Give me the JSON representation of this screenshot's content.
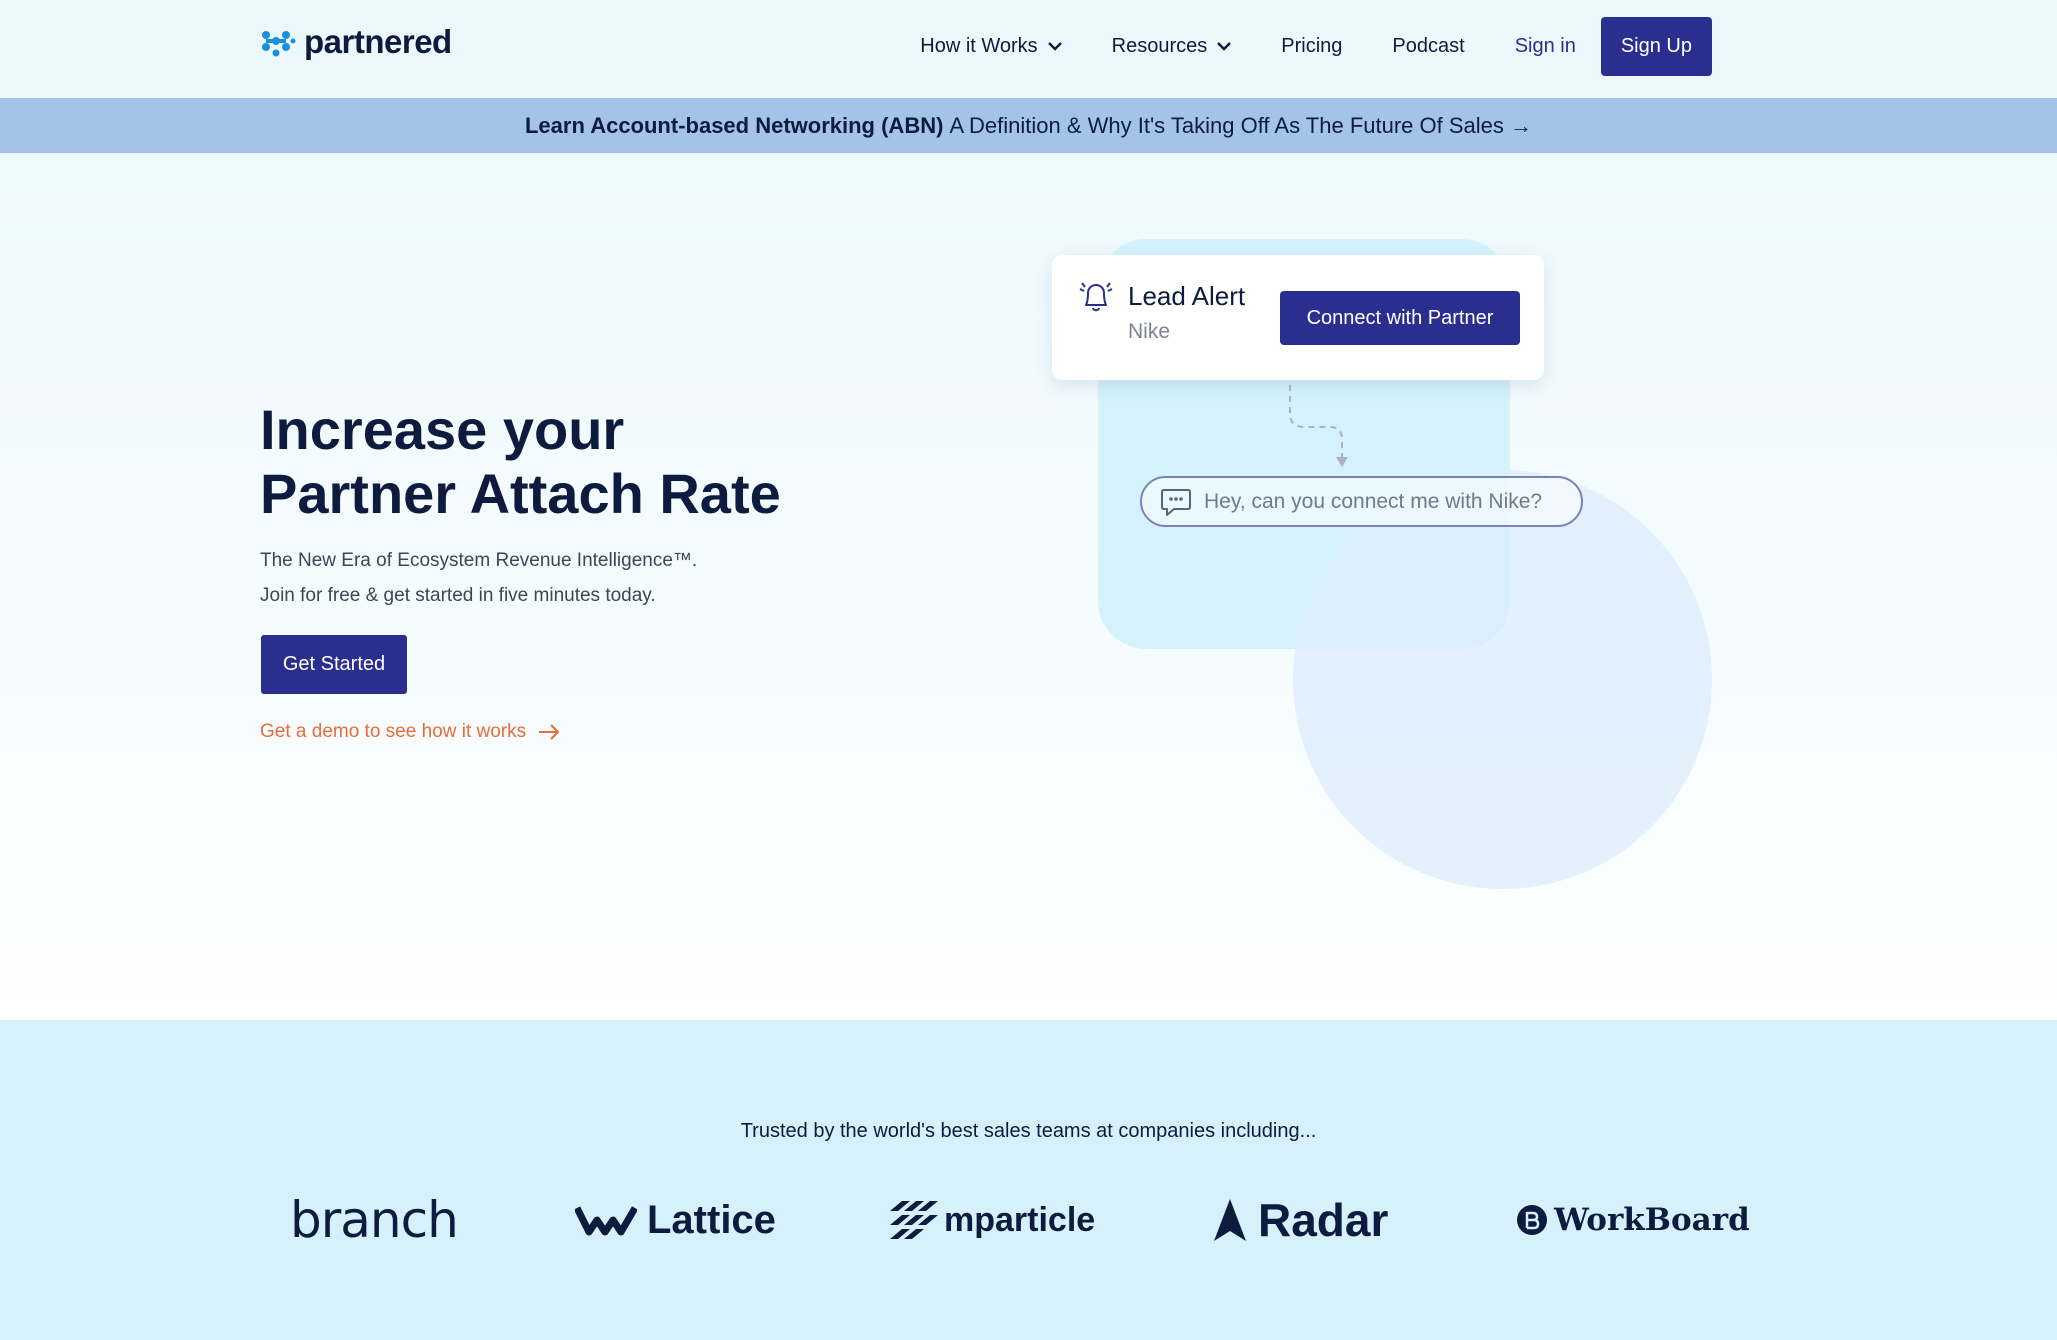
{
  "header": {
    "logo_text": "partnered",
    "nav": {
      "how_it_works": "How it Works",
      "resources": "Resources",
      "pricing": "Pricing",
      "podcast": "Podcast",
      "sign_in": "Sign in",
      "sign_up": "Sign Up"
    }
  },
  "banner": {
    "bold": "Learn Account-based Networking (ABN)",
    "rest": "A Definition & Why It's Taking Off As The Future Of Sales →"
  },
  "hero": {
    "title_line1": "Increase your",
    "title_line2": "Partner Attach Rate",
    "sub_line1": "The New Era of Ecosystem Revenue Intelligence™.",
    "sub_line2": "Join for free & get started in five minutes today.",
    "cta": "Get Started",
    "demo_link": "Get a demo to see how it works"
  },
  "alert": {
    "title": "Lead Alert",
    "company": "Nike",
    "button": "Connect with Partner",
    "chat": "Hey, can you connect me with Nike?"
  },
  "trusted": {
    "title": "Trusted by the world's best sales teams at companies including...",
    "logos": [
      "branch",
      "Lattice",
      "mparticle",
      "Radar",
      "WorkBoard"
    ]
  },
  "colors": {
    "primary": "#2a2f8f",
    "accent_orange": "#ea6c3a",
    "banner_bg": "#a3c3e8",
    "trusted_bg": "#d6f1fc",
    "text_dark": "#0d1b3e"
  }
}
